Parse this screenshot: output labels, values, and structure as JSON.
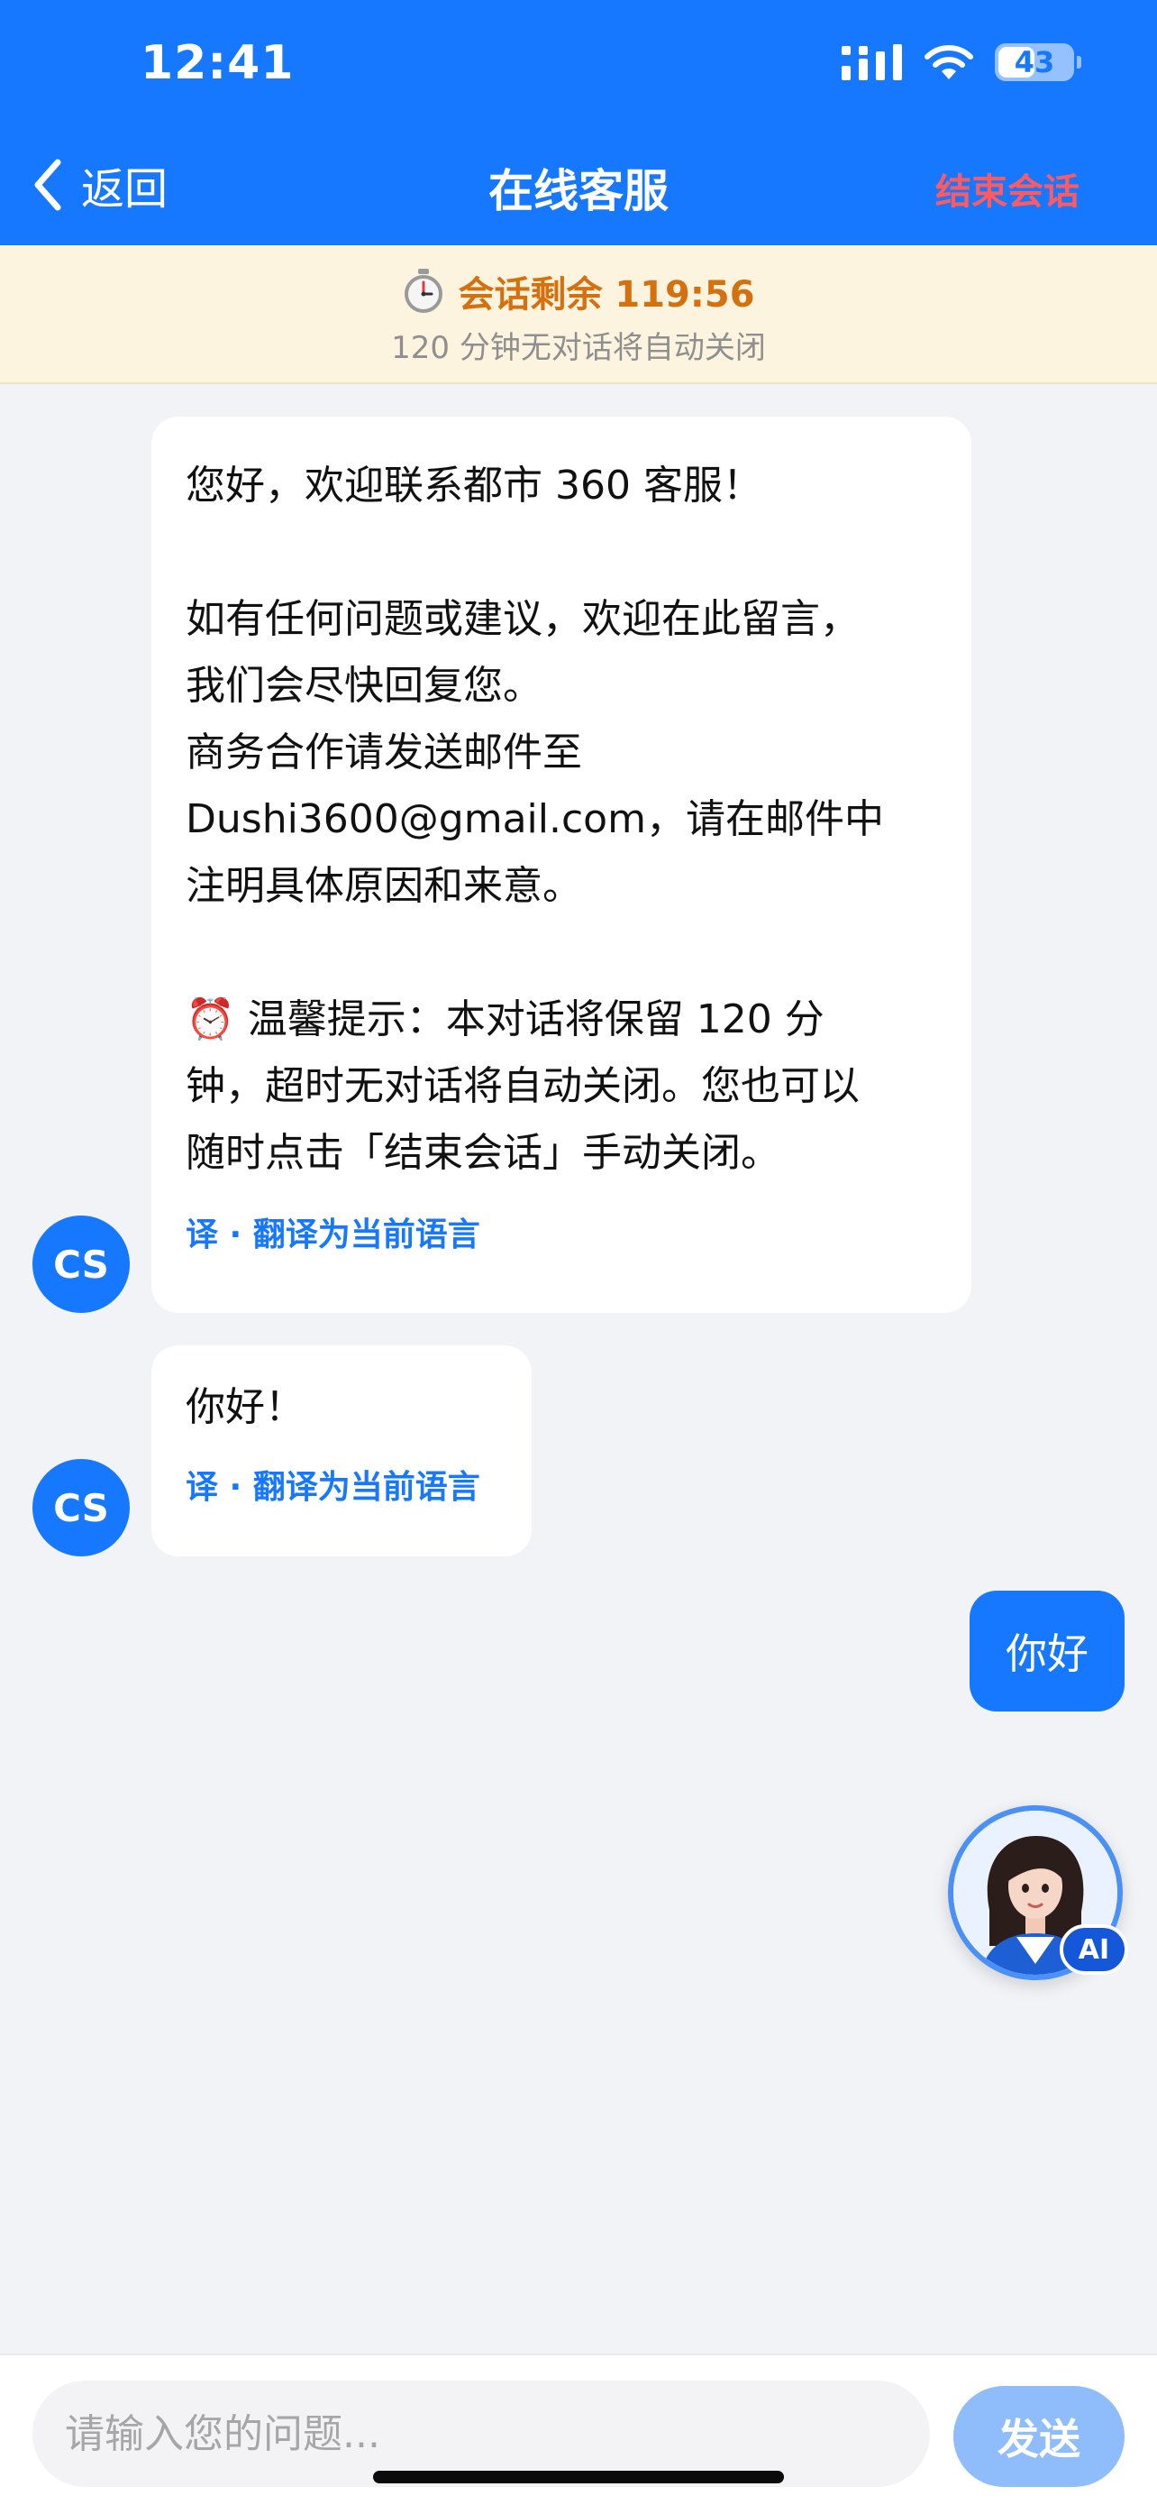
{
  "status_bar": {
    "time": "12:41",
    "battery": "43"
  },
  "nav": {
    "back_label": "返回",
    "title": "在线客服",
    "end_session_label": "结束会话"
  },
  "banner": {
    "timer_text": "会话剩余 119:56",
    "subtitle": "120 分钟无对话将自动关闭",
    "timer_color": "#d4710e"
  },
  "agent": {
    "avatar_text": "CS"
  },
  "messages": [
    {
      "direction": "incoming",
      "text": "您好，欢迎联系都市 360 客服！\n\n如有任何问题或建议，欢迎在此留言，\n我们会尽快回复您。\n商务合作请发送邮件至\nDushi3600@gmail.com，请在邮件中\n注明具体原因和来意。\n\n⏰ 温馨提示：本对话将保留 120 分\n钟，超时无对话将自动关闭。您也可以\n随时点击「结束会话」手动关闭。",
      "translate_label": "译 · 翻译为当前语言"
    },
    {
      "direction": "incoming",
      "text": "你好！",
      "translate_label": "译 · 翻译为当前语言"
    },
    {
      "direction": "outgoing",
      "text": "你好"
    }
  ],
  "ai_assistant": {
    "badge": "AI"
  },
  "composer": {
    "placeholder": "请输入您的问题...",
    "value": "",
    "send_label": "发送"
  },
  "colors": {
    "primary": "#1677ff",
    "danger": "#ff5a5f",
    "send_disabled": "#8fbcfb"
  }
}
